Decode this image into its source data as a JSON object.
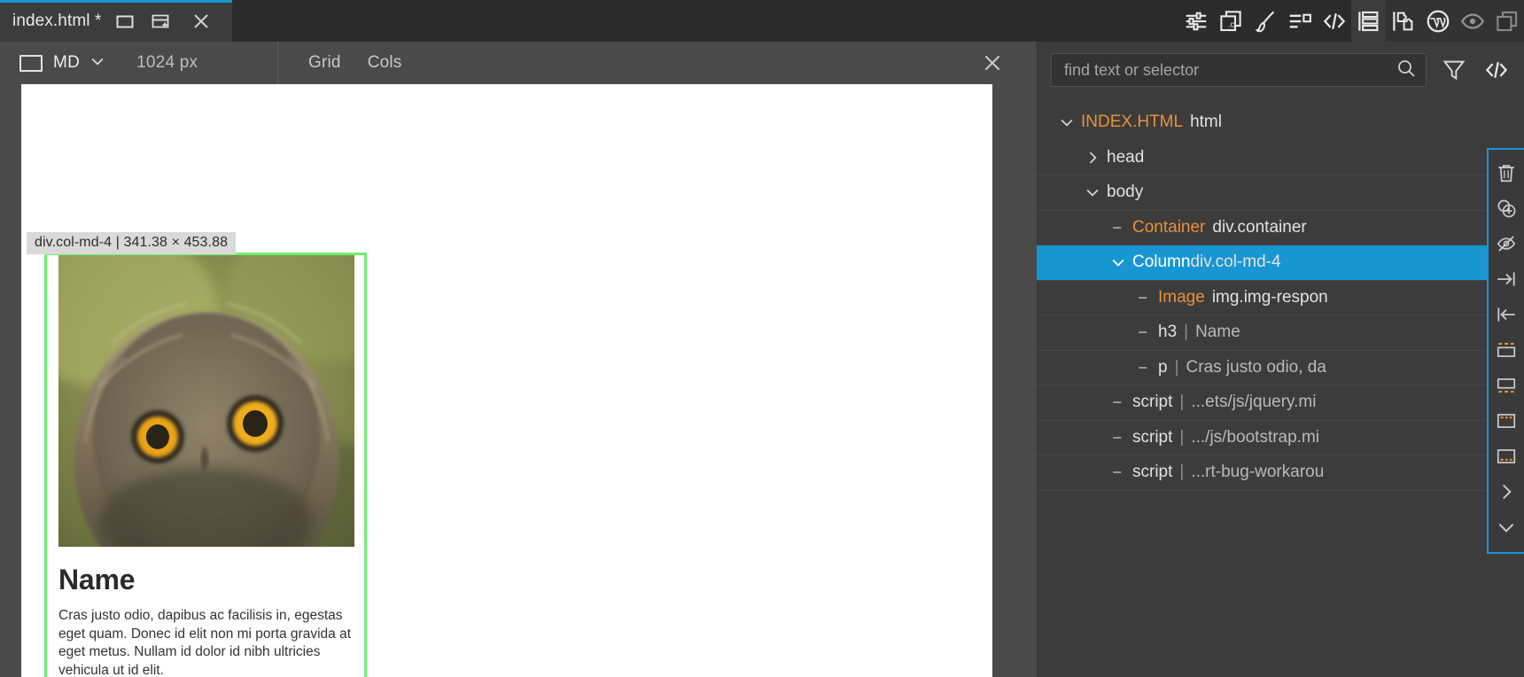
{
  "window": {
    "tab": {
      "title": "index.html *",
      "icons": [
        "window-icon",
        "new-window-icon",
        "close-icon"
      ]
    },
    "toolbar_icons": [
      {
        "name": "sliders-icon",
        "label": "Settings"
      },
      {
        "name": "css-file-icon",
        "label": "CSS"
      },
      {
        "name": "brush-icon",
        "label": "Style"
      },
      {
        "name": "text-align-icon",
        "label": "Text"
      },
      {
        "name": "code-icon",
        "label": "Code"
      },
      {
        "name": "layers-icon",
        "label": "Outline",
        "active": true
      },
      {
        "name": "puzzle-icon",
        "label": "Plugins"
      },
      {
        "name": "wordpress-icon",
        "label": "WordPress"
      },
      {
        "name": "eye-icon",
        "label": "Preview"
      },
      {
        "name": "copy-icon",
        "label": "Duplicate"
      }
    ]
  },
  "canvas_toolbar": {
    "breakpoint_icon": "viewport-icon",
    "breakpoint": "MD",
    "caret": "chevron-down-icon",
    "width": "1024 px",
    "buttons": [
      "Grid",
      "Cols"
    ],
    "close_icon": "close-icon"
  },
  "canvas": {
    "selection_badge": "div.col-md-4 | 341.38 × 453.88",
    "selection_color": "#6ff06f",
    "card": {
      "image_alt": "owl-photo",
      "title": "Name",
      "text": "Cras justo odio, dapibus ac facilisis in, egestas eget quam. Donec id elit non mi porta gravida at eget metus. Nullam id dolor id nibh ultricies vehicula ut id elit."
    }
  },
  "inspector": {
    "search": {
      "placeholder": "find text or selector",
      "value": "",
      "search_icon": "search-icon"
    },
    "header_icons": [
      {
        "name": "filter-tag-icon"
      },
      {
        "name": "code-brackets-icon"
      }
    ],
    "tree": [
      {
        "indent": 0,
        "twisty": "chevron-down-icon",
        "name": "INDEX.HTML",
        "name_color": "orange",
        "tag": "html",
        "text": "",
        "selected": false,
        "rule": false
      },
      {
        "indent": 1,
        "twisty": "chevron-right-icon",
        "name": "",
        "tag": "head",
        "text": "",
        "selected": false,
        "rule": true
      },
      {
        "indent": 1,
        "twisty": "chevron-down-icon",
        "name": "",
        "tag": "body",
        "text": "",
        "selected": false,
        "rule": true
      },
      {
        "indent": 2,
        "twisty": "dash-icon",
        "name": "Container",
        "name_color": "orange",
        "tag": "div.container",
        "text": "",
        "selected": false,
        "rule": true
      },
      {
        "indent": 2,
        "twisty": "chevron-down-icon",
        "name": "Column",
        "tag": "div.col-md-4",
        "text": "",
        "selected": true,
        "rule": true
      },
      {
        "indent": 3,
        "twisty": "dash-icon",
        "name": "Image",
        "name_color": "orange",
        "tag": "img.img-respon",
        "text": "",
        "selected": false,
        "rule": true
      },
      {
        "indent": 3,
        "twisty": "dash-icon",
        "name": "",
        "tag": "h3",
        "pipe": "|",
        "text": "Name",
        "selected": false,
        "rule": true
      },
      {
        "indent": 3,
        "twisty": "dash-icon",
        "name": "",
        "tag": "p",
        "pipe": "|",
        "text": "Cras justo odio, da",
        "selected": false,
        "rule": true
      },
      {
        "indent": 2,
        "twisty": "dash-icon",
        "name": "",
        "tag": "script",
        "pipe": "|",
        "text": "...ets/js/jquery.mi",
        "selected": false,
        "rule": true
      },
      {
        "indent": 2,
        "twisty": "dash-icon",
        "name": "",
        "tag": "script",
        "pipe": "|",
        "text": ".../js/bootstrap.mi",
        "selected": false,
        "rule": true
      },
      {
        "indent": 2,
        "twisty": "dash-icon",
        "name": "",
        "tag": "script",
        "pipe": "|",
        "text": "...rt-bug-workarou",
        "selected": false,
        "rule": true
      }
    ],
    "actions": [
      {
        "name": "delete-icon"
      },
      {
        "name": "add-node-icon"
      },
      {
        "name": "hide-element-icon"
      },
      {
        "name": "indent-right-icon"
      },
      {
        "name": "outdent-left-icon"
      },
      {
        "name": "margin-top-icon"
      },
      {
        "name": "margin-bottom-icon"
      },
      {
        "name": "padding-top-icon"
      },
      {
        "name": "padding-bottom-icon"
      },
      {
        "name": "chevron-right-icon"
      },
      {
        "name": "chevron-down-icon"
      }
    ],
    "accent_color": "#1896d1"
  }
}
